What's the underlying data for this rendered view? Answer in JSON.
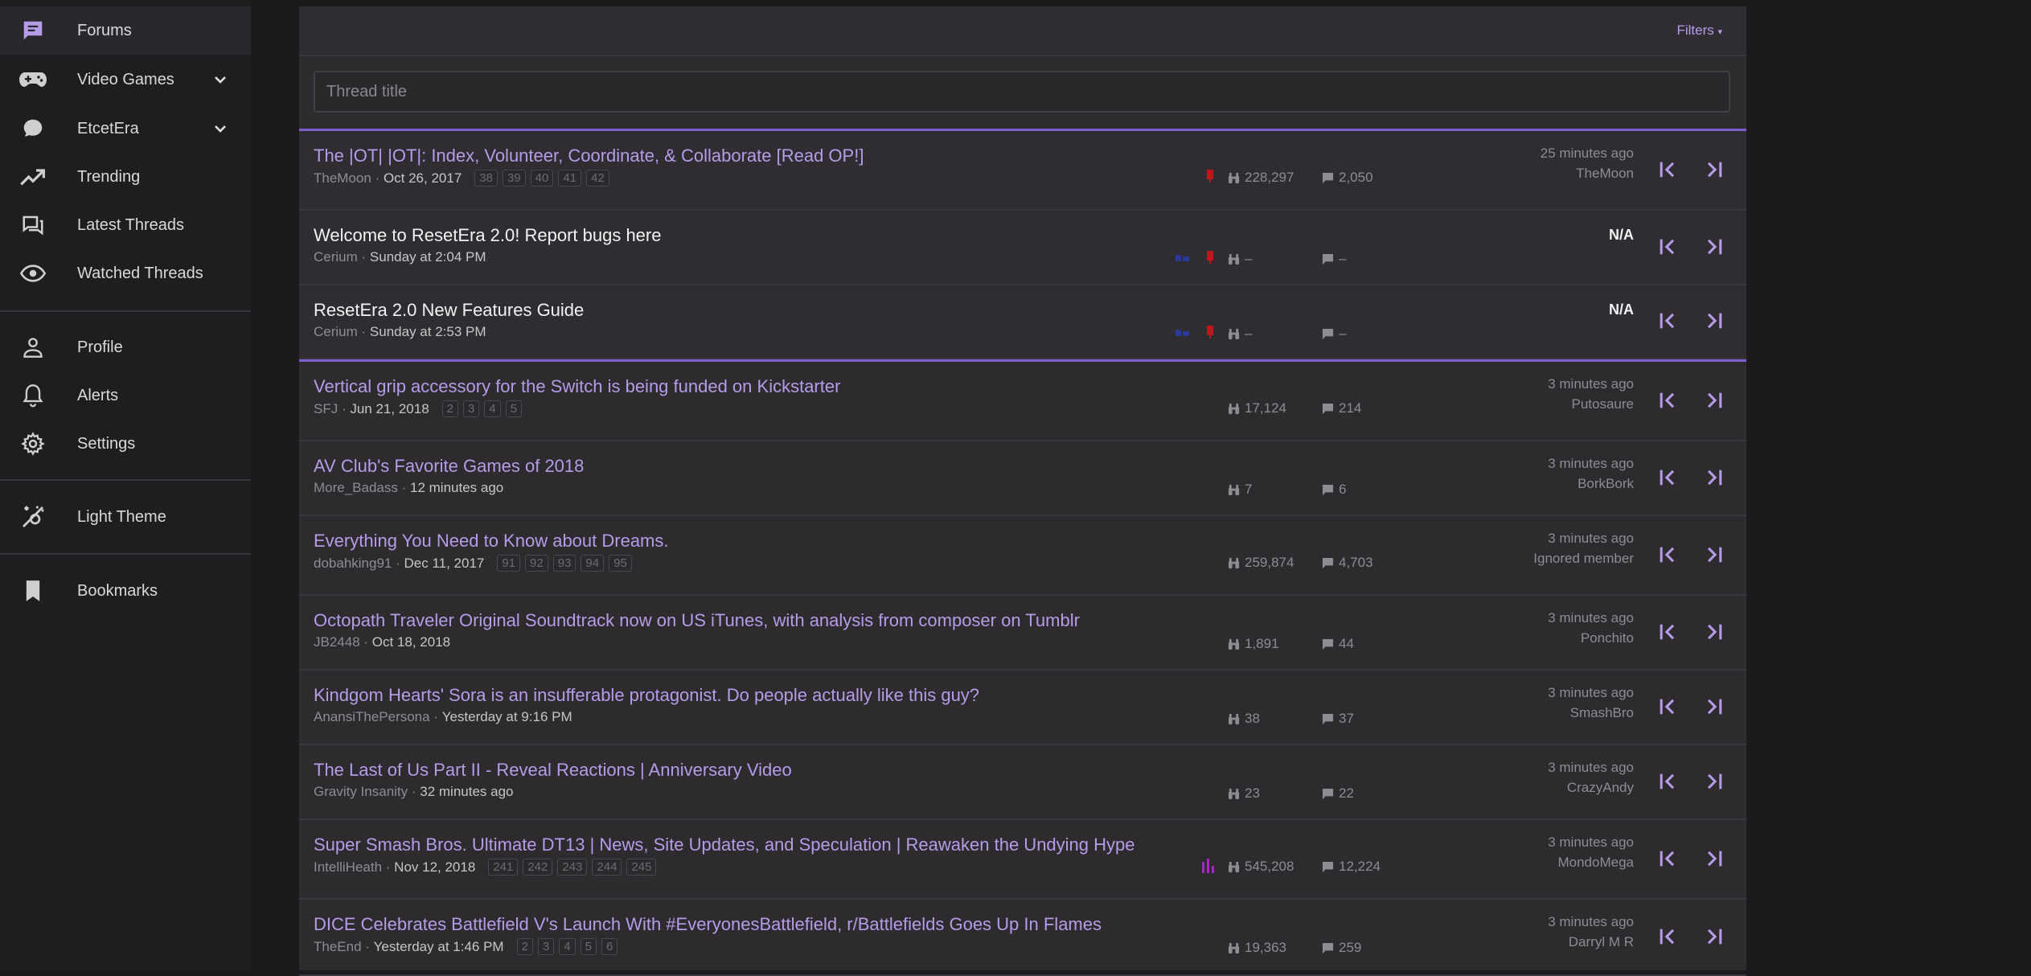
{
  "sidebar": {
    "items": [
      {
        "label": "Forums",
        "icon": "forum-icon"
      },
      {
        "label": "Video Games",
        "icon": "gamepad-icon"
      },
      {
        "label": "EtcetEra",
        "icon": "chat-bubble-icon"
      },
      {
        "label": "Trending",
        "icon": "trending-icon"
      },
      {
        "label": "Latest Threads",
        "icon": "latest-threads-icon"
      },
      {
        "label": "Watched Threads",
        "icon": "eye-icon"
      },
      {
        "label": "Profile",
        "icon": "person-icon"
      },
      {
        "label": "Alerts",
        "icon": "bell-icon"
      },
      {
        "label": "Settings",
        "icon": "gear-icon"
      },
      {
        "label": "Light Theme",
        "icon": "theme-toggle-icon"
      },
      {
        "label": "Bookmarks",
        "icon": "bookmark-icon"
      }
    ]
  },
  "header": {
    "filters_label": "Filters"
  },
  "search": {
    "placeholder": "Thread title"
  },
  "sticky_threads": [
    {
      "title": "The |OT| |OT|: Index, Volunteer, Coordinate, & Collaborate [Read OP!]",
      "author": "TheMoon",
      "date": "Oct 26, 2017",
      "pages": [
        "38",
        "39",
        "40",
        "41",
        "42"
      ],
      "views": "228,297",
      "replies": "2,050",
      "last_time": "25 minutes ago",
      "last_user": "TheMoon"
    },
    {
      "title": "Welcome to ResetEra 2.0! Report bugs here",
      "author": "Cerium",
      "date": "Sunday at 2:04 PM",
      "pages": [],
      "views": "–",
      "replies": "–",
      "last_time": "N/A",
      "last_user": ""
    },
    {
      "title": "ResetEra 2.0 New Features Guide",
      "author": "Cerium",
      "date": "Sunday at 2:53 PM",
      "pages": [],
      "views": "–",
      "replies": "–",
      "last_time": "N/A",
      "last_user": ""
    }
  ],
  "threads": [
    {
      "title": "Vertical grip accessory for the Switch is being funded on Kickstarter",
      "author": "SFJ",
      "date": "Jun 21, 2018",
      "pages": [
        "2",
        "3",
        "4",
        "5"
      ],
      "views": "17,124",
      "replies": "214",
      "last_time": "3 minutes ago",
      "last_user": "Putosaure"
    },
    {
      "title": "AV Club's Favorite Games of 2018",
      "author": "More_Badass",
      "date": "12 minutes ago",
      "pages": [],
      "views": "7",
      "replies": "6",
      "last_time": "3 minutes ago",
      "last_user": "BorkBork"
    },
    {
      "title": "Everything You Need to Know about Dreams.",
      "author": "dobahking91",
      "date": "Dec 11, 2017",
      "pages": [
        "91",
        "92",
        "93",
        "94",
        "95"
      ],
      "views": "259,874",
      "replies": "4,703",
      "last_time": "3 minutes ago",
      "last_user": "Ignored member"
    },
    {
      "title": "Octopath Traveler Original Soundtrack now on US iTunes, with analysis from composer on Tumblr",
      "author": "JB2448",
      "date": "Oct 18, 2018",
      "pages": [],
      "views": "1,891",
      "replies": "44",
      "last_time": "3 minutes ago",
      "last_user": "Ponchito"
    },
    {
      "title": "Kindgom Hearts' Sora is an insufferable protagonist. Do people actually like this guy?",
      "author": "AnansiThePersona",
      "date": "Yesterday at 9:16 PM",
      "pages": [],
      "views": "38",
      "replies": "37",
      "last_time": "3 minutes ago",
      "last_user": "SmashBro"
    },
    {
      "title": "The Last of Us Part II - Reveal Reactions | Anniversary Video",
      "author": "Gravity Insanity",
      "date": "32 minutes ago",
      "pages": [],
      "views": "23",
      "replies": "22",
      "last_time": "3 minutes ago",
      "last_user": "CrazyAndy"
    },
    {
      "title": "Super Smash Bros. Ultimate DT13 | News, Site Updates, and Speculation | Reawaken the Undying Hype",
      "author": "IntelliHeath",
      "date": "Nov 12, 2018",
      "pages": [
        "241",
        "242",
        "243",
        "244",
        "245"
      ],
      "views": "545,208",
      "replies": "12,224",
      "last_time": "3 minutes ago",
      "last_user": "MondoMega"
    },
    {
      "title": "DICE Celebrates Battlefield V's Launch With #EveryonesBattlefield, r/Battlefields Goes Up In Flames",
      "author": "TheEnd",
      "date": "Yesterday at 1:46 PM",
      "pages": [
        "2",
        "3",
        "4",
        "5",
        "6"
      ],
      "views": "19,363",
      "replies": "259",
      "last_time": "3 minutes ago",
      "last_user": "Darryl M R"
    }
  ],
  "colors": {
    "accent": "#b69be8",
    "separator": "#7f5fcf",
    "pin_red": "#c0161c",
    "poll_purple": "#a624c8",
    "staff_blue": "#2a3a9c"
  }
}
